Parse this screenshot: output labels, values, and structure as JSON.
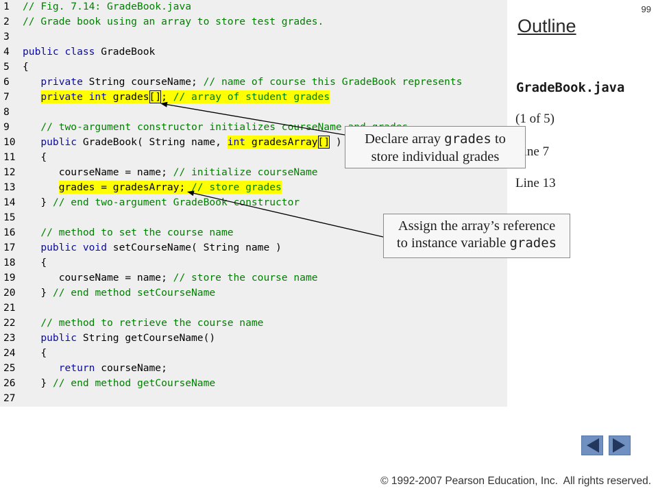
{
  "slide": {
    "page_number": "99"
  },
  "outline_panel": {
    "title": "Outline",
    "file_name": "GradeBook.java",
    "part": "(1 of 5)",
    "line_refs": [
      "Line 7",
      "Line 13"
    ]
  },
  "code": {
    "lines": [
      {
        "number": "1",
        "segments": [
          {
            "text": "// Fig. 7.14: GradeBook.java",
            "style": "comment"
          }
        ]
      },
      {
        "number": "2",
        "segments": [
          {
            "text": "// Grade book using an array to store test grades.",
            "style": "comment"
          }
        ]
      },
      {
        "number": "3",
        "segments": []
      },
      {
        "number": "4",
        "segments": [
          {
            "text": "public class",
            "style": "keyword"
          },
          {
            "text": " GradeBook"
          }
        ]
      },
      {
        "number": "5",
        "segments": [
          {
            "text": "{"
          }
        ]
      },
      {
        "number": "6",
        "segments": [
          {
            "text": "   "
          },
          {
            "text": "private",
            "style": "keyword"
          },
          {
            "text": " String courseName; "
          },
          {
            "text": "// name of course this GradeBook represents",
            "style": "comment"
          }
        ]
      },
      {
        "number": "7",
        "segments": [
          {
            "text": "   "
          },
          {
            "text": "private int",
            "style": "keyword",
            "highlight": true
          },
          {
            "text": " grades",
            "highlight": true
          },
          {
            "text": "[]",
            "highlight": true,
            "boxed": true
          },
          {
            "text": "; ",
            "highlight": true
          },
          {
            "text": "// array of student grades",
            "style": "comment",
            "highlight": true
          }
        ]
      },
      {
        "number": "8",
        "segments": []
      },
      {
        "number": "9",
        "segments": [
          {
            "text": "   "
          },
          {
            "text": "// two-argument constructor initializes courseName and grades",
            "style": "comment"
          }
        ]
      },
      {
        "number": "10",
        "segments": [
          {
            "text": "   "
          },
          {
            "text": "public",
            "style": "keyword"
          },
          {
            "text": " GradeBook( String name, "
          },
          {
            "text": "int",
            "style": "keyword",
            "highlight": true
          },
          {
            "text": " gradesArray",
            "highlight": true
          },
          {
            "text": "[]",
            "highlight": true,
            "boxed": true
          },
          {
            "text": " )"
          }
        ]
      },
      {
        "number": "11",
        "segments": [
          {
            "text": "   {"
          }
        ]
      },
      {
        "number": "12",
        "segments": [
          {
            "text": "      courseName = name; "
          },
          {
            "text": "// initialize courseName",
            "style": "comment"
          }
        ]
      },
      {
        "number": "13",
        "segments": [
          {
            "text": "      "
          },
          {
            "text": "grades = gradesArray; ",
            "highlight": true
          },
          {
            "text": "// store grades",
            "style": "comment",
            "highlight": true
          }
        ]
      },
      {
        "number": "14",
        "segments": [
          {
            "text": "   } "
          },
          {
            "text": "// end two-argument GradeBook constructor",
            "style": "comment"
          }
        ]
      },
      {
        "number": "15",
        "segments": []
      },
      {
        "number": "16",
        "segments": [
          {
            "text": "   "
          },
          {
            "text": "// method to set the course name",
            "style": "comment"
          }
        ]
      },
      {
        "number": "17",
        "segments": [
          {
            "text": "   "
          },
          {
            "text": "public void",
            "style": "keyword"
          },
          {
            "text": " setCourseName( String name )"
          }
        ]
      },
      {
        "number": "18",
        "segments": [
          {
            "text": "   {"
          }
        ]
      },
      {
        "number": "19",
        "segments": [
          {
            "text": "      courseName = name; "
          },
          {
            "text": "// store the course name",
            "style": "comment"
          }
        ]
      },
      {
        "number": "20",
        "segments": [
          {
            "text": "   } "
          },
          {
            "text": "// end method setCourseName",
            "style": "comment"
          }
        ]
      },
      {
        "number": "21",
        "segments": []
      },
      {
        "number": "22",
        "segments": [
          {
            "text": "   "
          },
          {
            "text": "// method to retrieve the course name",
            "style": "comment"
          }
        ]
      },
      {
        "number": "23",
        "segments": [
          {
            "text": "   "
          },
          {
            "text": "public",
            "style": "keyword"
          },
          {
            "text": " String getCourseName()"
          }
        ]
      },
      {
        "number": "24",
        "segments": [
          {
            "text": "   {"
          }
        ]
      },
      {
        "number": "25",
        "segments": [
          {
            "text": "      "
          },
          {
            "text": "return",
            "style": "keyword"
          },
          {
            "text": " courseName;"
          }
        ]
      },
      {
        "number": "26",
        "segments": [
          {
            "text": "   } "
          },
          {
            "text": "// end method getCourseName",
            "style": "comment"
          }
        ]
      },
      {
        "number": "27",
        "segments": []
      }
    ]
  },
  "callouts": [
    {
      "lines": [
        {
          "parts": [
            {
              "text": "Declare array "
            },
            {
              "text": "grades",
              "mono": true
            },
            {
              "text": " to"
            }
          ]
        },
        {
          "parts": [
            {
              "text": "store individual grades"
            }
          ]
        }
      ]
    },
    {
      "lines": [
        {
          "parts": [
            {
              "text": "Assign the array’s reference"
            }
          ]
        },
        {
          "parts": [
            {
              "text": "to instance variable "
            },
            {
              "text": "grades",
              "mono": true
            }
          ]
        }
      ]
    }
  ],
  "navigation": {
    "prev_icon": "triangle-left-icon",
    "next_icon": "triangle-right-icon"
  },
  "footer": {
    "copyright": "© 1992-2007 Pearson Education, Inc.  All rights reserved."
  },
  "colors": {
    "code_background": "#efefef",
    "keyword": "#0a0aa0",
    "comment": "#008000",
    "highlight": "#ffff00",
    "nav_button": "#6f90c0",
    "nav_arrow": "#23375c"
  }
}
